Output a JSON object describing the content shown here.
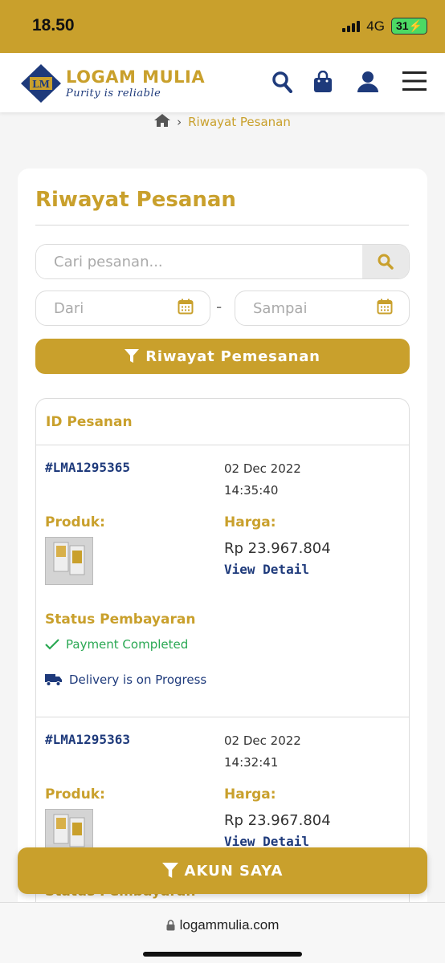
{
  "status_bar": {
    "time": "18.50",
    "network": "4G",
    "battery": "31"
  },
  "header": {
    "logo_mark": "LM",
    "brand": "LOGAM MULIA",
    "tagline": "Purity is reliable",
    "icons": [
      "search-icon",
      "shopping-bag-icon",
      "user-icon",
      "menu-icon"
    ]
  },
  "breadcrumb": {
    "current": "Riwayat Pesanan"
  },
  "page": {
    "title": "Riwayat Pesanan",
    "search_placeholder": "Cari pesanan...",
    "from_placeholder": "Dari",
    "date_separator": "-",
    "to_placeholder": "Sampai",
    "filter_button": "Riwayat Pemesanan"
  },
  "orders": {
    "header": "ID Pesanan",
    "product_label": "Produk:",
    "price_label": "Harga:",
    "payment_status_label": "Status Pembayaran",
    "view_detail": "View Detail",
    "items": [
      {
        "id": "#LMA1295365",
        "date": "02 Dec 2022",
        "time": "14:35:40",
        "price": "Rp 23.967.804",
        "payment_status": "Payment Completed",
        "delivery_status": "Delivery is on Progress"
      },
      {
        "id": "#LMA1295363",
        "date": "02 Dec 2022",
        "time": "14:32:41",
        "price": "Rp 23.967.804",
        "payment_status": "Status Pembayaran"
      }
    ]
  },
  "bottom_button": "AKUN SAYA",
  "browser": {
    "url": "logammulia.com"
  },
  "colors": {
    "gold": "#c9a02c",
    "navy": "#1e3a7b",
    "success": "#2aa853"
  }
}
